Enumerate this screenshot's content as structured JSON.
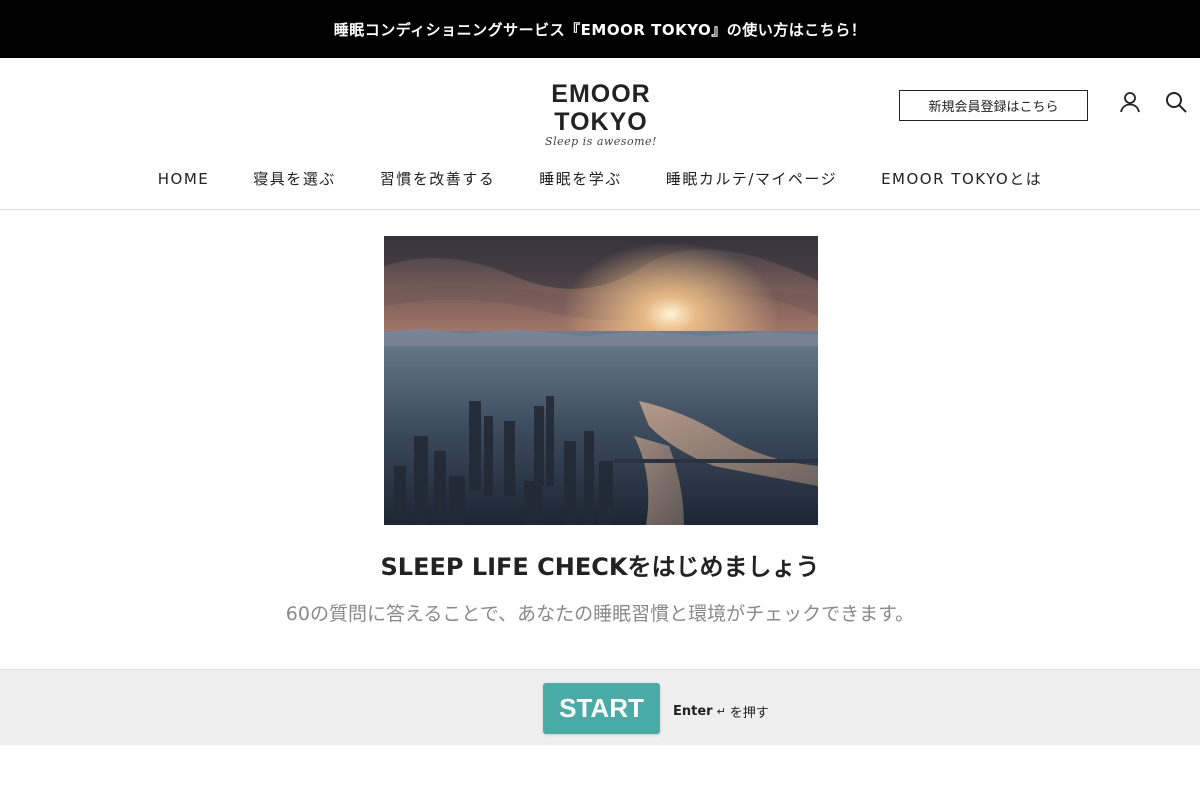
{
  "announcement": {
    "text": "睡眠コンディショニングサービス『EMOOR TOKYO』の使い方はこちら！"
  },
  "header": {
    "logo_main": "EMOOR TOKYO",
    "logo_sub": "Sleep is awesome!",
    "register_label": "新規会員登録はこちら",
    "account_icon": "user-icon",
    "search_icon": "search-icon"
  },
  "nav": {
    "items": [
      "HOME",
      "寝具を選ぶ",
      "習慣を改善する",
      "睡眠を学ぶ",
      "睡眠カルテ/マイページ",
      "EMOOR TOKYOとは"
    ]
  },
  "main": {
    "title": "SLEEP LIFE CHECKをはじめましょう",
    "subtitle": "60の質問に答えることで、あなたの睡眠習慣と環境がチェックできます。"
  },
  "footer": {
    "start_label": "START",
    "enter_key": "Enter",
    "enter_glyph": "↵",
    "enter_suffix": "を押す",
    "accent_color": "#4aaaa5"
  }
}
